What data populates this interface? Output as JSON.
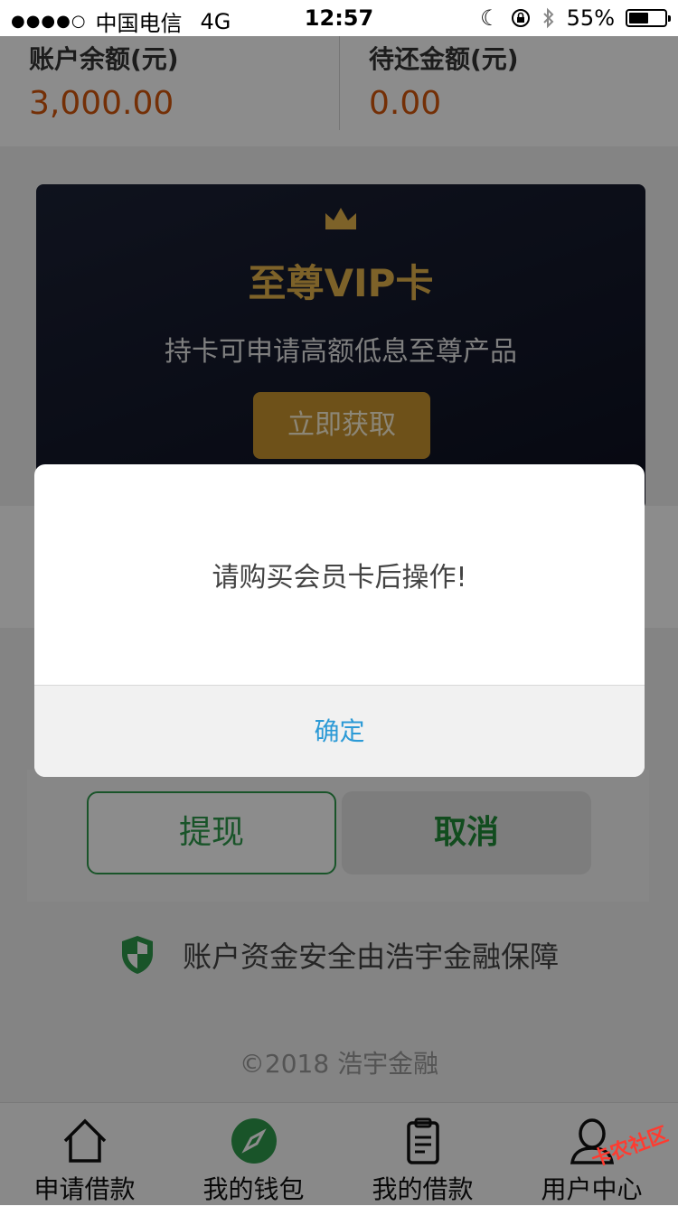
{
  "status_bar": {
    "carrier": "中国电信",
    "network": "4G",
    "time": "12:57",
    "battery": "55%",
    "battery_level": 0.55
  },
  "balances": {
    "account_label": "账户余额(元)",
    "account_value": "3,000.00",
    "due_label": "待还金额(元)",
    "due_value": "0.00"
  },
  "vip_card": {
    "title": "至尊VIP卡",
    "description": "持卡可申请高额低息至尊产品",
    "cta": "立即获取"
  },
  "actions": {
    "withdraw": "提现",
    "cancel": "取消"
  },
  "security_note": "账户资金安全由浩宇金融保障",
  "copyright": "©2018 浩宇金融",
  "tabs": [
    {
      "label": "申请借款",
      "icon": "home-icon"
    },
    {
      "label": "我的钱包",
      "icon": "compass-icon"
    },
    {
      "label": "我的借款",
      "icon": "document-icon"
    },
    {
      "label": "用户中心",
      "icon": "user-icon"
    }
  ],
  "dialog": {
    "message": "请购买会员卡后操作!",
    "confirm": "确定"
  },
  "watermark": "卡农社区",
  "colors": {
    "accent_green": "#2e9a4b",
    "balance_orange": "#d4570b",
    "vip_gold": "#e4b24b",
    "link_blue": "#2c9ad6"
  }
}
